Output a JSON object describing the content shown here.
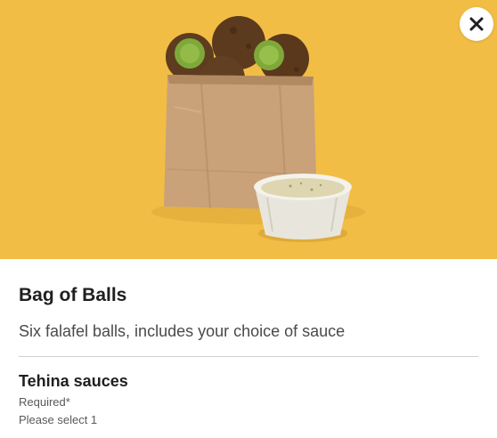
{
  "item": {
    "title": "Bag of Balls",
    "description": "Six falafel balls, includes your choice of sauce"
  },
  "options": {
    "title": "Tehina sauces",
    "required_label": "Required*",
    "select_hint": "Please select 1"
  },
  "hero": {
    "image_label": "falafel-bag-photo",
    "background_color": "#f2bd45"
  },
  "close": {
    "icon": "close-icon"
  }
}
